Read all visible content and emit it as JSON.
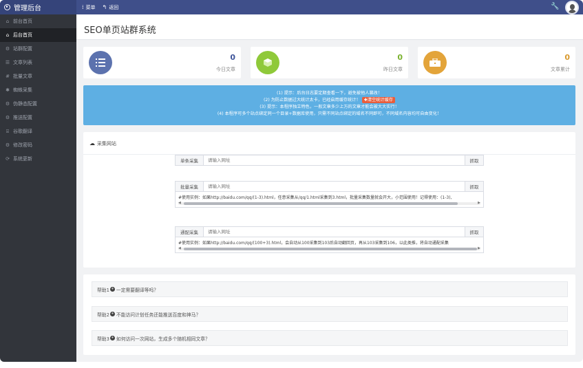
{
  "header": {
    "app_title": "管理后台",
    "menu_label": "菜单",
    "back_label": "返回"
  },
  "sidebar": {
    "items": [
      {
        "label": "前台首页",
        "icon": "home-icon",
        "active": false
      },
      {
        "label": "后台首页",
        "icon": "home-icon",
        "active": true
      },
      {
        "label": "站群配置",
        "icon": "gear-icon",
        "active": false
      },
      {
        "label": "文章列表",
        "icon": "list-icon",
        "active": false
      },
      {
        "label": "批量文章",
        "icon": "hash-icon",
        "active": false
      },
      {
        "label": "蜘蛛采集",
        "icon": "spider-icon",
        "active": false
      },
      {
        "label": "伪静态配置",
        "icon": "gear-icon",
        "active": false
      },
      {
        "label": "推送配置",
        "icon": "gear-icon",
        "active": false
      },
      {
        "label": "谷歌翻译",
        "icon": "bank-icon",
        "active": false
      },
      {
        "label": "修改密码",
        "icon": "gear-icon",
        "active": false
      },
      {
        "label": "系统更新",
        "icon": "update-icon",
        "active": false
      }
    ]
  },
  "page": {
    "title": "SEO单页站群系统"
  },
  "stats": [
    {
      "value": "0",
      "label": "今日文章",
      "color": "#5c72ae",
      "value_color": "#3f559a",
      "icon": "list-icon"
    },
    {
      "value": "0",
      "label": "昨日文章",
      "color": "#8fc93a",
      "value_color": "#7ab22e",
      "icon": "cube-icon"
    },
    {
      "value": "0",
      "label": "文章累计",
      "color": "#e3a43a",
      "value_color": "#d99a2f",
      "icon": "briefcase-icon"
    }
  ],
  "notice": {
    "line1": "(1) 提示：后台日志要定期查看一下，避免被他人篡改！",
    "line2": "(2) 为防止数据过大统计太卡，已经启用缓存统计！",
    "line2_badge": "✚清空统计缓存",
    "line3": "(3) 提示：本程序独立特色，一般文章多少上万的文章才能会被大大实行！",
    "line4": "(4) 本程序可多个站点绑定同一个目录+数据库使用，只需不同站点绑定的域名不同即可，不同域名内容均可自由变化！"
  },
  "collect": {
    "panel_title": "采集网站",
    "single": {
      "label": "单条采集",
      "placeholder": "请输入网址",
      "button": "抓取"
    },
    "batch": {
      "label": "批量采集",
      "placeholder": "请输入网址",
      "button": "抓取",
      "example": "#使用实例：如果http://baidu.com/qq/(1-3).html，任意采集从/qq/1.html采集到3.html，批量采集数量就会开大，小范围使用！记得使用：(1-3),"
    },
    "regular": {
      "label": "通配采集",
      "placeholder": "请输入网址",
      "button": "抓取",
      "example": "#使用实例：如果http://baidu.com/qq/(100+3).html，会自动从100采集到103后自动翻回页，再从103采集到106，以此类推，将自动通配采集"
    }
  },
  "help": [
    {
      "prefix": "帮助1",
      "text": "一定需要翻译等吗？"
    },
    {
      "prefix": "帮助2",
      "text": "不能访问计划任务还能推送百度和神马？"
    },
    {
      "prefix": "帮助3",
      "text": "如何访问一次网站，生成多个随机相同文章？"
    }
  ]
}
